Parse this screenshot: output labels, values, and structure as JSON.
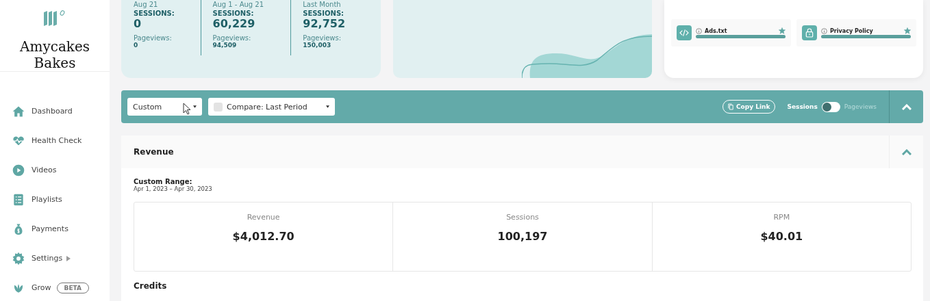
{
  "sidebar": {
    "site_name": "Amycakes Bakes",
    "items": [
      {
        "label": "Dashboard",
        "selected": false
      },
      {
        "label": "Health Check",
        "selected": false
      },
      {
        "label": "Videos",
        "selected": false
      },
      {
        "label": "Playlists",
        "selected": false
      },
      {
        "label": "Payments",
        "selected": false
      },
      {
        "label": "Settings",
        "selected": false,
        "submenu": true
      },
      {
        "label": "Grow",
        "selected": false,
        "badge": "BETA"
      }
    ]
  },
  "stats": [
    {
      "period": "Aug 21",
      "sessions_label": "SESSIONS:",
      "sessions": "0",
      "pageviews_label": "Pageviews:",
      "pageviews": "0"
    },
    {
      "period": "Aug 1 - Aug 21",
      "sessions_label": "SESSIONS:",
      "sessions": "60,229",
      "pageviews_label": "Pageviews:",
      "pageviews": "94,509"
    },
    {
      "period": "Last Month",
      "sessions_label": "SESSIONS:",
      "sessions": "92,752",
      "pageviews_label": "Pageviews:",
      "pageviews": "150,003"
    }
  ],
  "checklist": [
    {
      "label": "Ads.txt",
      "starred": true,
      "level": 1
    },
    {
      "label": "Privacy Policy",
      "starred": true,
      "level": 1
    }
  ],
  "toolbar": {
    "range": "Custom",
    "compare": {
      "label": "Compare: Last Period",
      "checked": false
    },
    "copy_link": "Copy Link",
    "metric_toggle": [
      {
        "label": "Sessions",
        "selected": true
      },
      {
        "label": "Pageviews",
        "selected": false
      }
    ],
    "expanded": true
  },
  "revenue": {
    "title": "Revenue",
    "expanded": true,
    "range_label": "Custom Range:",
    "range": "Apr 1, 2023 – Apr 30, 2023",
    "metrics": [
      {
        "label": "Revenue",
        "value": "$4,012.70"
      },
      {
        "label": "Sessions",
        "value": "100,197"
      },
      {
        "label": "RPM",
        "value": "$40.01"
      }
    ],
    "next_section": "Credits"
  }
}
